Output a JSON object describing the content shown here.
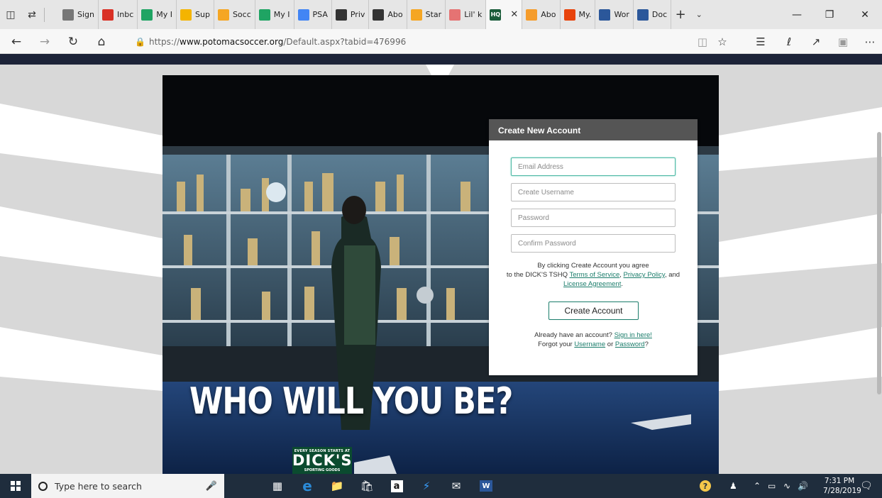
{
  "browser": {
    "tabs": [
      {
        "label": "Sign",
        "icon": "page-icon",
        "color": "#777777"
      },
      {
        "label": "Inbc",
        "icon": "gmail-icon",
        "color": "#d93025"
      },
      {
        "label": "My I",
        "icon": "drive-icon",
        "color": "#1fa463"
      },
      {
        "label": "Sup",
        "icon": "folder-icon",
        "color": "#f4b400"
      },
      {
        "label": "Socc",
        "icon": "soccer-icon",
        "color": "#f5a623"
      },
      {
        "label": "My I",
        "icon": "drive-icon",
        "color": "#1fa463"
      },
      {
        "label": "PSA",
        "icon": "docs-icon",
        "color": "#4285f4"
      },
      {
        "label": "Priv",
        "icon": "ball-icon",
        "color": "#333333"
      },
      {
        "label": "Abo",
        "icon": "ball-icon",
        "color": "#333333"
      },
      {
        "label": "Star",
        "icon": "star-icon",
        "color": "#f5a623"
      },
      {
        "label": "Lil' k",
        "icon": "tshirt-icon",
        "color": "#e57373"
      },
      {
        "label": "",
        "icon": "tshq-icon",
        "color": "#1a5c3a",
        "active": true
      },
      {
        "label": "Abo",
        "icon": "circle-icon",
        "color": "#f59c2b"
      },
      {
        "label": "My.",
        "icon": "office-icon",
        "color": "#e8430b"
      },
      {
        "label": "Wor",
        "icon": "word-icon",
        "color": "#2b579a"
      },
      {
        "label": "Doc",
        "icon": "word-icon",
        "color": "#2b579a"
      }
    ],
    "tshq_fav_text": "HQ",
    "address": {
      "scheme": "https://",
      "host": "www.potomacsoccer.org",
      "path": "/Default.aspx?tabid=476996"
    }
  },
  "hero": {
    "headline": "WHO WILL YOU BE?",
    "sponsor": {
      "tagline": "EVERY SEASON STARTS AT",
      "name": "DICK'S",
      "sub": "SPORTING GOODS"
    }
  },
  "form": {
    "title": "Create New Account",
    "fields": {
      "email": "Email Address",
      "username": "Create Username",
      "password": "Password",
      "confirm": "Confirm Password"
    },
    "agree_text_1": "By clicking Create Account you agree",
    "agree_text_2": "to the DICK'S TSHQ",
    "terms_link": "Terms of Service",
    "privacy_link": "Privacy Policy",
    "and_text": ", and",
    "license_link": "License Agreement",
    "submit_label": "Create Account",
    "already_text": "Already have an account?",
    "signin_link": "Sign in here!",
    "forgot_text": "Forgot your",
    "username_link": "Username",
    "or_text": "or",
    "password_link": "Password"
  },
  "taskbar": {
    "search_placeholder": "Type here to search",
    "time": "7:31 PM",
    "date": "7/28/2019"
  }
}
